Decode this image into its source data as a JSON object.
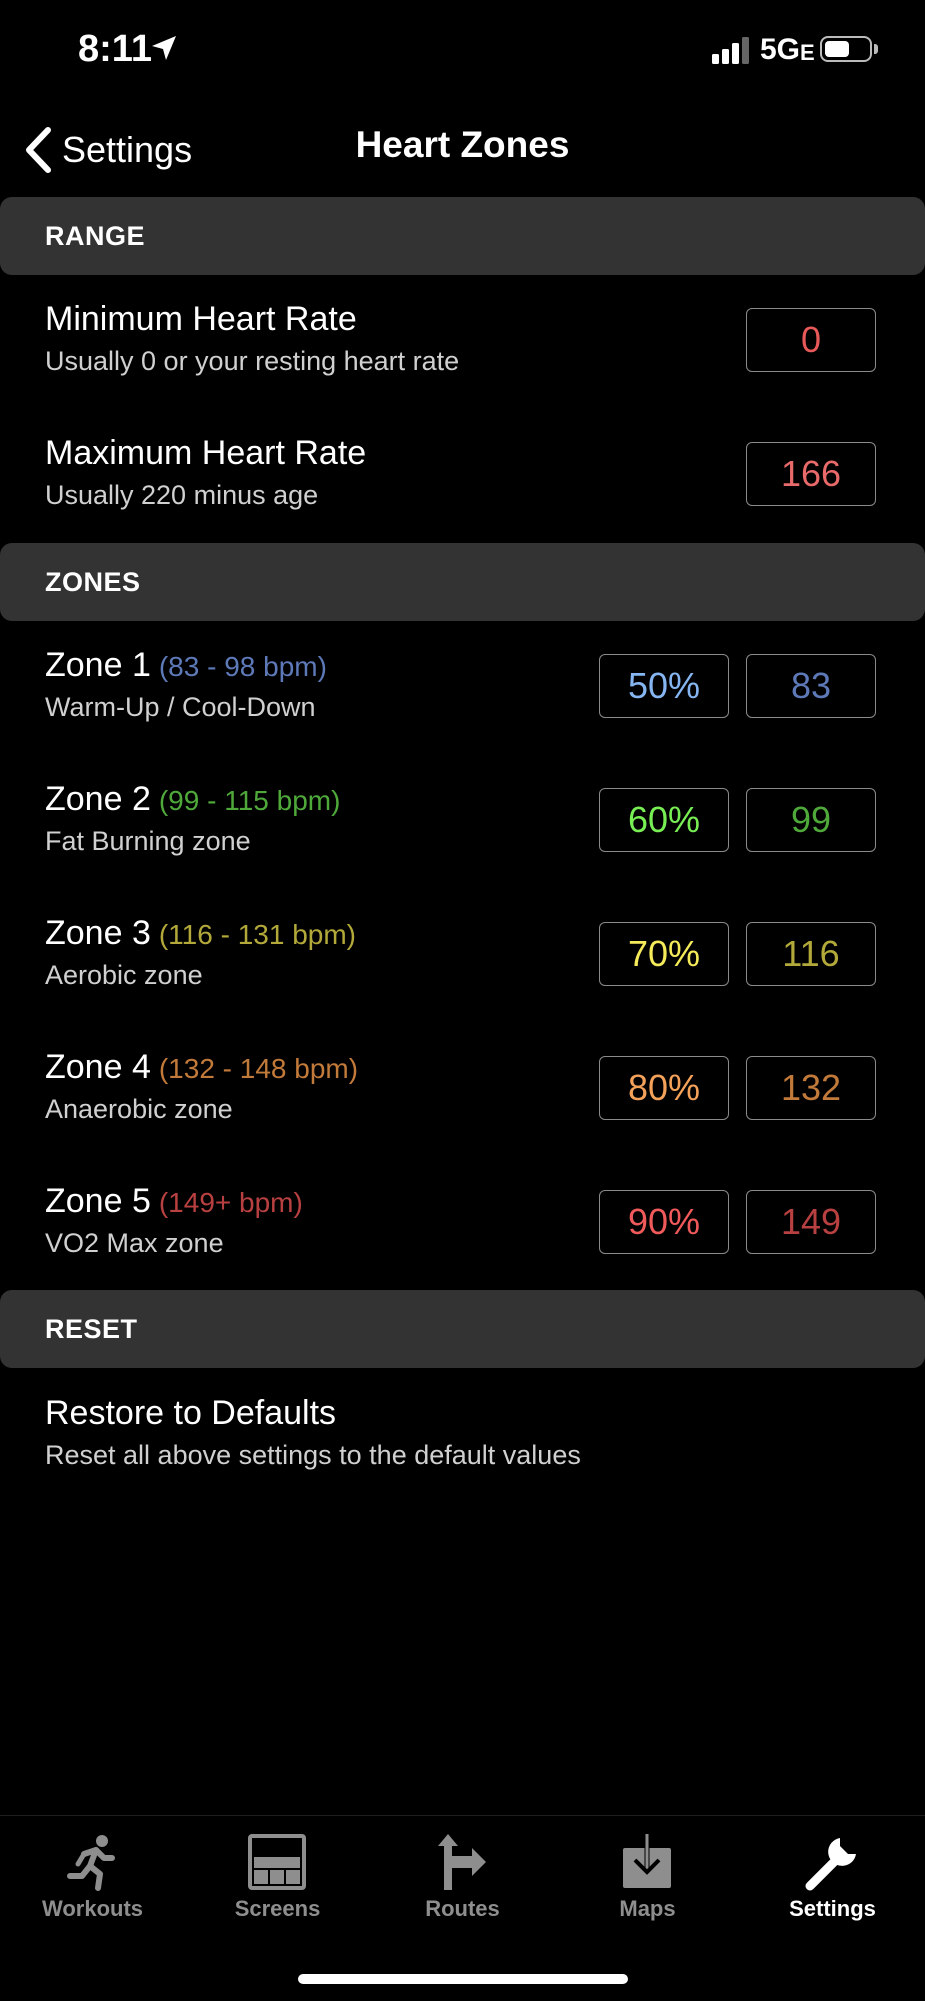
{
  "status_bar": {
    "time": "8:11",
    "network": "5G",
    "network_suffix": "E"
  },
  "nav": {
    "back_label": "Settings",
    "title": "Heart Zones"
  },
  "sections": {
    "range": "RANGE",
    "zones": "ZONES",
    "reset": "RESET"
  },
  "range": {
    "min": {
      "title": "Minimum Heart Rate",
      "subtitle": "Usually 0 or your resting heart rate",
      "value": "0",
      "color": "#e85a5a"
    },
    "max": {
      "title": "Maximum Heart Rate",
      "subtitle": "Usually 220 minus age",
      "value": "166",
      "color": "#e86a6a"
    }
  },
  "zones": [
    {
      "title": "Zone 1",
      "range": "(83 - 98 bpm)",
      "subtitle": "Warm-Up / Cool-Down",
      "percent": "50%",
      "bpm": "83",
      "range_color": "#5d79b8",
      "percent_color": "#86b6f2",
      "bpm_color": "#5d79b8"
    },
    {
      "title": "Zone 2",
      "range": "(99 - 115 bpm)",
      "subtitle": "Fat Burning zone",
      "percent": "60%",
      "bpm": "99",
      "range_color": "#4fa83a",
      "percent_color": "#78ee55",
      "bpm_color": "#4fa83a"
    },
    {
      "title": "Zone 3",
      "range": "(116 - 131 bpm)",
      "subtitle": "Aerobic zone",
      "percent": "70%",
      "bpm": "116",
      "range_color": "#b3a93a",
      "percent_color": "#f4ea5a",
      "bpm_color": "#b3a93a"
    },
    {
      "title": "Zone 4",
      "range": "(132 - 148 bpm)",
      "subtitle": "Anaerobic zone",
      "percent": "80%",
      "bpm": "132",
      "range_color": "#c27a3a",
      "percent_color": "#f4a15a",
      "bpm_color": "#c27a3a"
    },
    {
      "title": "Zone 5",
      "range": "(149+ bpm)",
      "subtitle": "VO2 Max zone",
      "percent": "90%",
      "bpm": "149",
      "range_color": "#b84040",
      "percent_color": "#f05a5a",
      "bpm_color": "#b84040"
    }
  ],
  "reset": {
    "title": "Restore to Defaults",
    "subtitle": "Reset all above settings to the default values"
  },
  "tabs": [
    {
      "label": "Workouts",
      "icon": "running-person-icon",
      "active": false
    },
    {
      "label": "Screens",
      "icon": "screens-grid-icon",
      "active": false
    },
    {
      "label": "Routes",
      "icon": "route-sign-icon",
      "active": false
    },
    {
      "label": "Maps",
      "icon": "map-download-icon",
      "active": false
    },
    {
      "label": "Settings",
      "icon": "wrench-icon",
      "active": true
    }
  ]
}
